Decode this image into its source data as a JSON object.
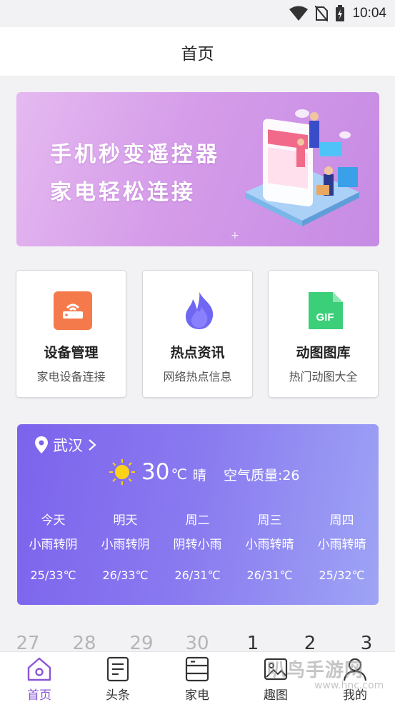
{
  "status_bar": {
    "time": "10:04",
    "icons": [
      "wifi-icon",
      "no-sim-icon",
      "battery-charging-icon"
    ]
  },
  "header": {
    "title": "首页"
  },
  "banner": {
    "line1": "手机秒变遥控器",
    "line2": "家电轻松连接"
  },
  "cards": [
    {
      "title": "设备管理",
      "subtitle": "家电设备连接",
      "icon": "router-icon",
      "color": "#f47a4c"
    },
    {
      "title": "热点资讯",
      "subtitle": "网络热点信息",
      "icon": "flame-icon",
      "color": "#6f66f2"
    },
    {
      "title": "动图图库",
      "subtitle": "热门动图大全",
      "icon": "gif-file-icon",
      "icon_text": "GIF",
      "color": "#3ccf7a"
    }
  ],
  "weather": {
    "city": "武汉",
    "temp": "30",
    "unit": "℃",
    "condition": "晴",
    "aqi": "空气质量:26",
    "forecast": [
      {
        "day": "今天",
        "cond": "小雨转阴",
        "range": "25/33℃"
      },
      {
        "day": "明天",
        "cond": "小雨转阴",
        "range": "26/33℃"
      },
      {
        "day": "周二",
        "cond": "阴转小雨",
        "range": "26/31℃"
      },
      {
        "day": "周三",
        "cond": "小雨转晴",
        "range": "26/31℃"
      },
      {
        "day": "周四",
        "cond": "小雨转晴",
        "range": "25/32℃"
      }
    ]
  },
  "calendar": {
    "days": [
      "27",
      "28",
      "29",
      "30",
      "1",
      "2",
      "3"
    ]
  },
  "bottom_nav": {
    "items": [
      {
        "label": "首页",
        "icon": "home-icon",
        "active": true
      },
      {
        "label": "头条",
        "icon": "news-icon",
        "active": false
      },
      {
        "label": "家电",
        "icon": "appliance-icon",
        "active": false
      },
      {
        "label": "趣图",
        "icon": "fun-image-icon",
        "active": false
      },
      {
        "label": "我的",
        "icon": "profile-icon",
        "active": false
      }
    ]
  },
  "watermark": {
    "text": "叭鸟手游网",
    "sub": "www.hnc.com"
  },
  "colors": {
    "accent": "#8a55d6",
    "weather_start": "#7c63ec",
    "weather_end": "#9ea4f5",
    "banner": "#d59ce9"
  }
}
